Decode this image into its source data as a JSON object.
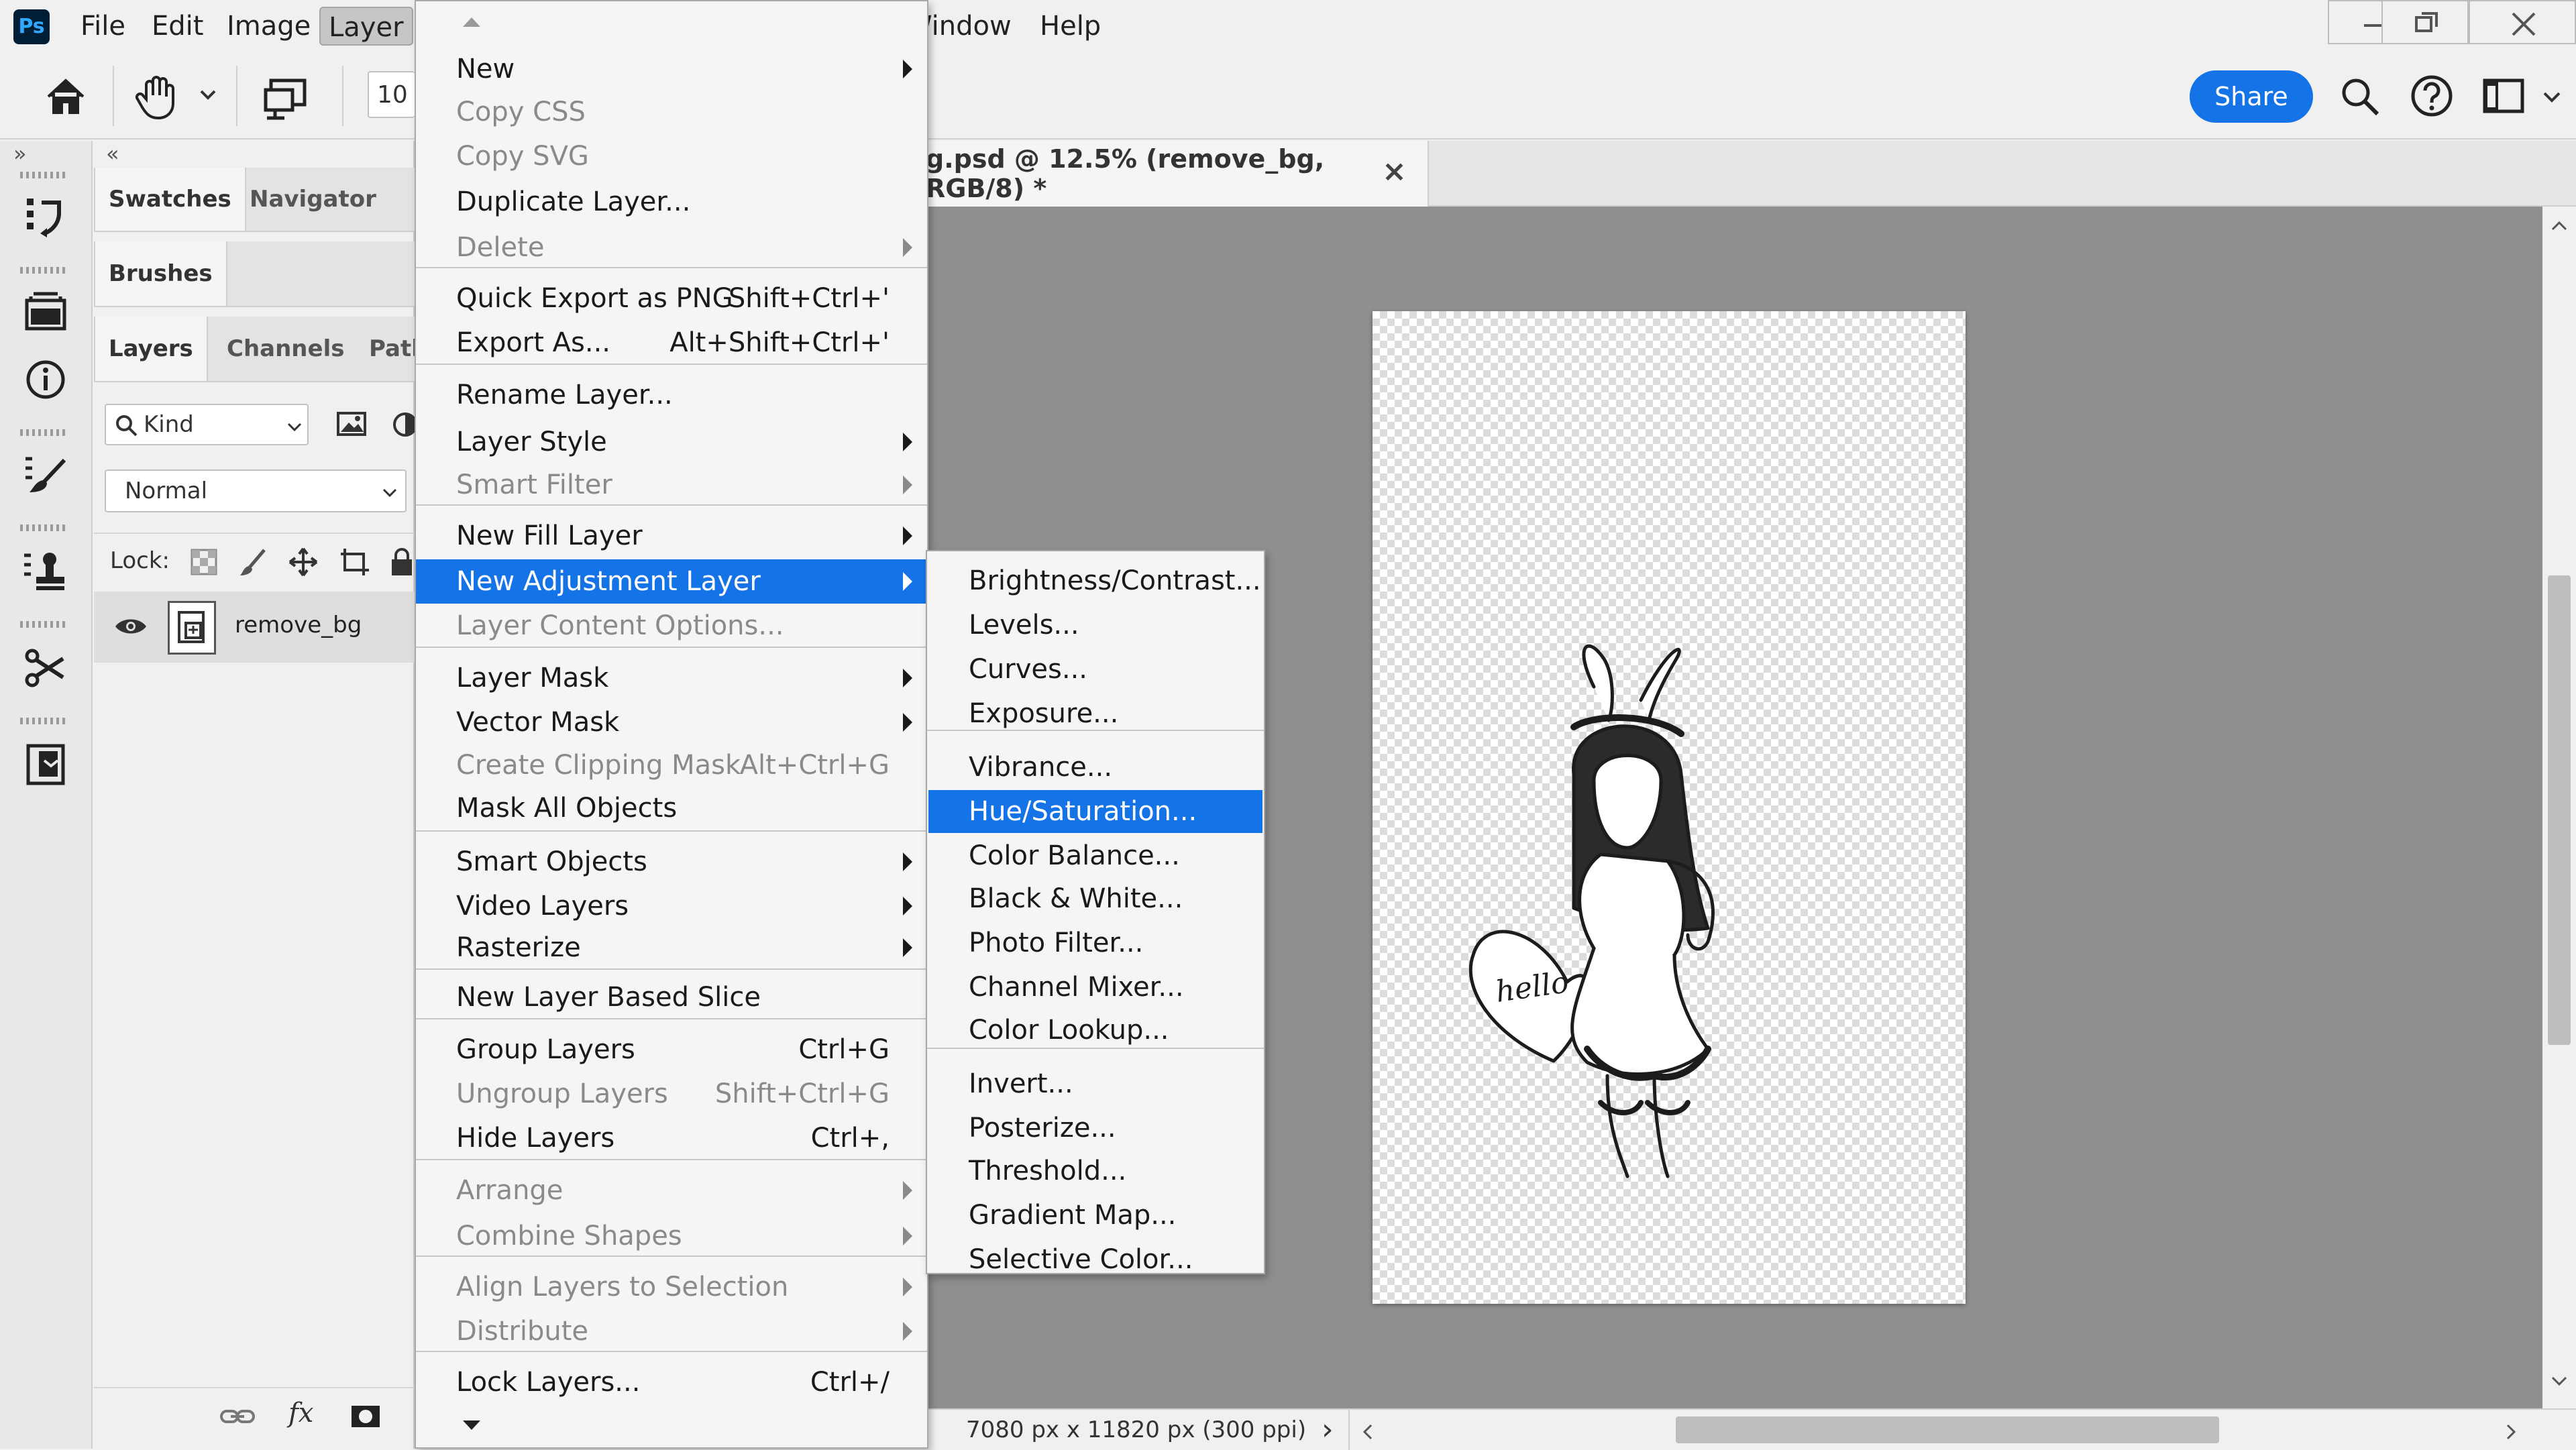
{
  "app": {
    "logo": "Ps",
    "accent": "#1473e6"
  },
  "menubar": {
    "file": "File",
    "edit": "Edit",
    "image": "Image",
    "layer": "Layer",
    "window": "Window",
    "help": "Help"
  },
  "options": {
    "zoom_value": "10",
    "share_label": "Share"
  },
  "panels": {
    "tabs_top": [
      "Swatches",
      "Navigator"
    ],
    "tabs_mid": [
      "Brushes"
    ],
    "tabs_layers": [
      "Layers",
      "Channels",
      "Paths"
    ],
    "kind_label": "Kind",
    "blend_mode": "Normal",
    "lock_label": "Lock:",
    "layer_name": "remove_bg",
    "fx_label": "fx"
  },
  "document": {
    "tab_title": "g.psd @ 12.5% (remove_bg, RGB/8) *",
    "close": "×",
    "status": "7080 px x 11820 px (300 ppi)",
    "status_arrow": "›"
  },
  "artwork": {
    "text": "hello"
  },
  "layer_menu": [
    {
      "label": "New",
      "submenu": true
    },
    {
      "label": "Copy CSS",
      "disabled": true
    },
    {
      "label": "Copy SVG",
      "disabled": true
    },
    {
      "label": "Duplicate Layer..."
    },
    {
      "label": "Delete",
      "disabled": true,
      "submenu": true
    },
    {
      "sep": true
    },
    {
      "label": "Quick Export as PNG",
      "shortcut": "Shift+Ctrl+'"
    },
    {
      "label": "Export As...",
      "shortcut": "Alt+Shift+Ctrl+'"
    },
    {
      "sep": true
    },
    {
      "label": "Rename Layer..."
    },
    {
      "label": "Layer Style",
      "submenu": true
    },
    {
      "label": "Smart Filter",
      "disabled": true,
      "submenu": true
    },
    {
      "sep": true
    },
    {
      "label": "New Fill Layer",
      "submenu": true
    },
    {
      "label": "New Adjustment Layer",
      "submenu": true,
      "highlighted": true
    },
    {
      "label": "Layer Content Options...",
      "disabled": true
    },
    {
      "sep": true
    },
    {
      "label": "Layer Mask",
      "submenu": true
    },
    {
      "label": "Vector Mask",
      "submenu": true
    },
    {
      "label": "Create Clipping Mask",
      "shortcut": "Alt+Ctrl+G",
      "disabled": true
    },
    {
      "label": "Mask All Objects"
    },
    {
      "sep": true
    },
    {
      "label": "Smart Objects",
      "submenu": true
    },
    {
      "label": "Video Layers",
      "submenu": true
    },
    {
      "label": "Rasterize",
      "submenu": true
    },
    {
      "sep": true
    },
    {
      "label": "New Layer Based Slice"
    },
    {
      "sep": true
    },
    {
      "label": "Group Layers",
      "shortcut": "Ctrl+G"
    },
    {
      "label": "Ungroup Layers",
      "shortcut": "Shift+Ctrl+G",
      "disabled": true
    },
    {
      "label": "Hide Layers",
      "shortcut": "Ctrl+,"
    },
    {
      "sep": true
    },
    {
      "label": "Arrange",
      "disabled": true,
      "submenu": true
    },
    {
      "label": "Combine Shapes",
      "disabled": true,
      "submenu": true
    },
    {
      "sep": true
    },
    {
      "label": "Align Layers to Selection",
      "disabled": true,
      "submenu": true
    },
    {
      "label": "Distribute",
      "disabled": true,
      "submenu": true
    },
    {
      "sep": true
    },
    {
      "label": "Lock Layers...",
      "shortcut": "Ctrl+/"
    }
  ],
  "adjustment_menu": [
    {
      "label": "Brightness/Contrast..."
    },
    {
      "label": "Levels..."
    },
    {
      "label": "Curves..."
    },
    {
      "label": "Exposure..."
    },
    {
      "sep": true
    },
    {
      "label": "Vibrance..."
    },
    {
      "label": "Hue/Saturation...",
      "highlighted": true
    },
    {
      "label": "Color Balance..."
    },
    {
      "label": "Black & White..."
    },
    {
      "label": "Photo Filter..."
    },
    {
      "label": "Channel Mixer..."
    },
    {
      "label": "Color Lookup..."
    },
    {
      "sep": true
    },
    {
      "label": "Invert..."
    },
    {
      "label": "Posterize..."
    },
    {
      "label": "Threshold..."
    },
    {
      "label": "Gradient Map..."
    },
    {
      "label": "Selective Color..."
    }
  ]
}
